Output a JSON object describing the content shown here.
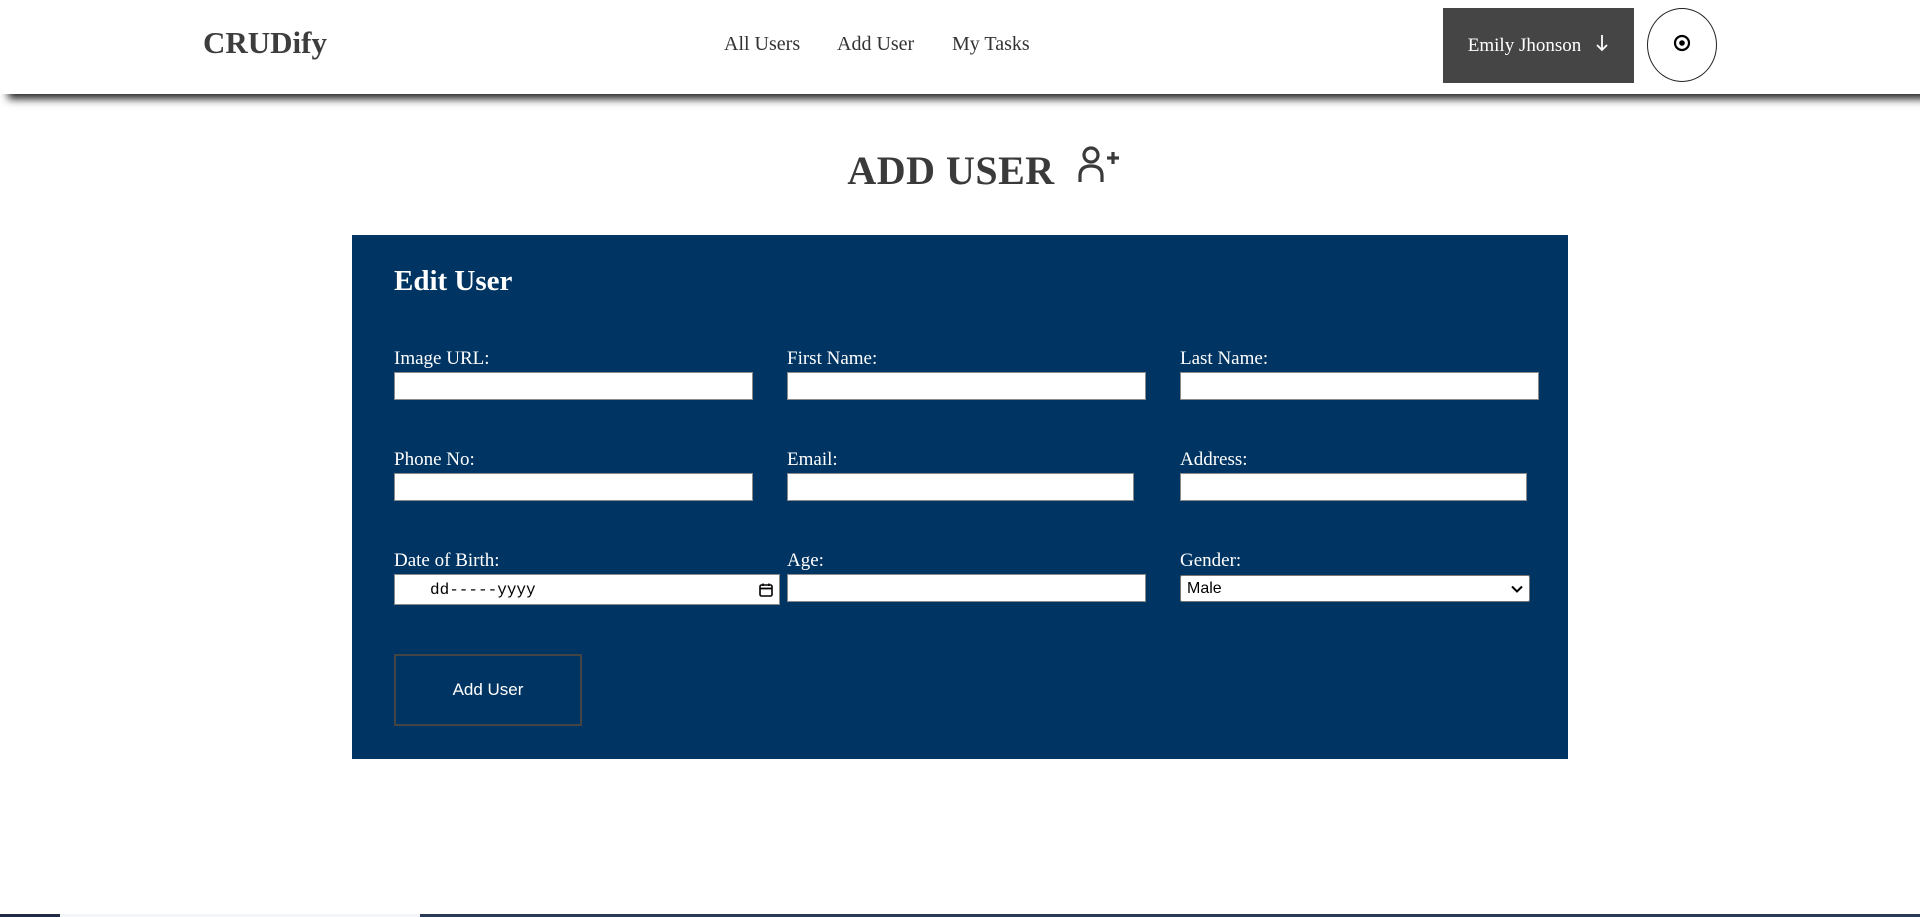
{
  "navbar": {
    "brand": "CRUDify",
    "links": [
      "All Users",
      "Add User",
      "My Tasks"
    ],
    "user_name": "Emily Jhonson",
    "user_menu_icon": "arrow-down-icon",
    "theme_toggle_icon": "target-icon"
  },
  "page": {
    "title": "ADD USER",
    "title_icon": "user-plus-icon"
  },
  "form": {
    "heading": "Edit User",
    "fields": {
      "image_url": {
        "label": "Image URL:",
        "value": ""
      },
      "first_name": {
        "label": "First Name:",
        "value": ""
      },
      "last_name": {
        "label": "Last Name:",
        "value": ""
      },
      "phone": {
        "label": "Phone No:",
        "value": ""
      },
      "email": {
        "label": "Email:",
        "value": ""
      },
      "address": {
        "label": "Address:",
        "value": ""
      },
      "dob": {
        "label": "Date of Birth:",
        "placeholder": "dd-----yyyy"
      },
      "age": {
        "label": "Age:",
        "value": ""
      },
      "gender": {
        "label": "Gender:",
        "value": "Male"
      }
    },
    "submit_label": "Add User"
  },
  "colors": {
    "card_background": "#003462",
    "user_menu_background": "#454545",
    "text_dark": "#3a3a3a"
  }
}
